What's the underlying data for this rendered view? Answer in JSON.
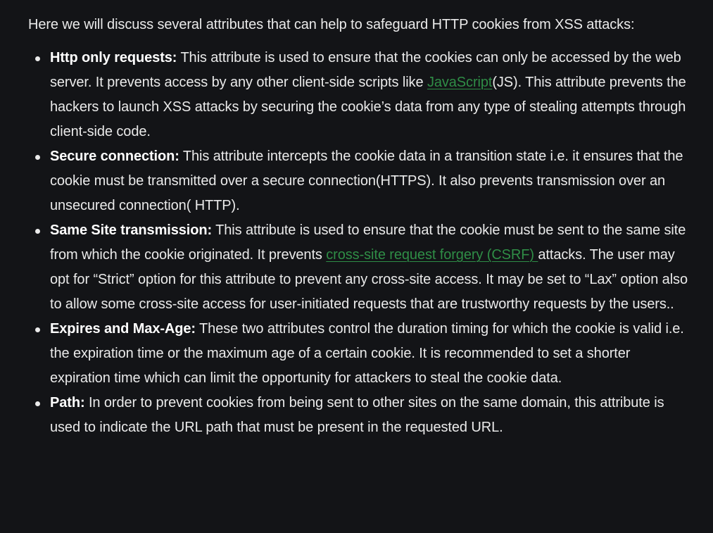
{
  "intro": "Here we will discuss several attributes that can help to safeguard HTTP cookies from XSS attacks:",
  "items": [
    {
      "term": "Http only requests:",
      "text_before": " This attribute is used to ensure that the cookies can only be accessed by the web server. It prevents access by any other client-side scripts like ",
      "link": "JavaScript",
      "text_after": "(JS). This attribute prevents the hackers to launch XSS attacks by securing the cookie’s data from any type of stealing attempts through client-side code."
    },
    {
      "term": "Secure connection:",
      "text_before": " This attribute intercepts the cookie data in a transition state i.e. it ensures that the cookie must be transmitted over a secure connection(HTTPS). It also prevents transmission over an unsecured connection( HTTP).",
      "link": "",
      "text_after": ""
    },
    {
      "term": "Same Site transmission:",
      "text_before": " This attribute is used to ensure that the cookie must be sent to the same site from which the cookie originated. It prevents ",
      "link": "cross-site request forgery (CSRF) ",
      "text_after": "attacks. The user may opt for “Strict” option for this attribute to prevent any cross-site access. It may be set to “Lax” option also to allow some cross-site access for user-initiated requests that are trustworthy requests by the users.."
    },
    {
      "term": "Expires and Max-Age:",
      "text_before": " These two attributes control the duration timing for which the cookie is valid i.e. the expiration time or the maximum age of a certain cookie. It is recommended to set a shorter expiration time which can limit the opportunity for attackers to steal the cookie data.",
      "link": "",
      "text_after": ""
    },
    {
      "term": "Path:",
      "text_before": " In order to prevent cookies from being sent to other sites on the same domain, this attribute is used to indicate the URL path that must be present in the requested URL.",
      "link": "",
      "text_after": ""
    }
  ],
  "colors": {
    "background": "#131417",
    "text": "#eaeaea",
    "link": "#2f8d46"
  }
}
